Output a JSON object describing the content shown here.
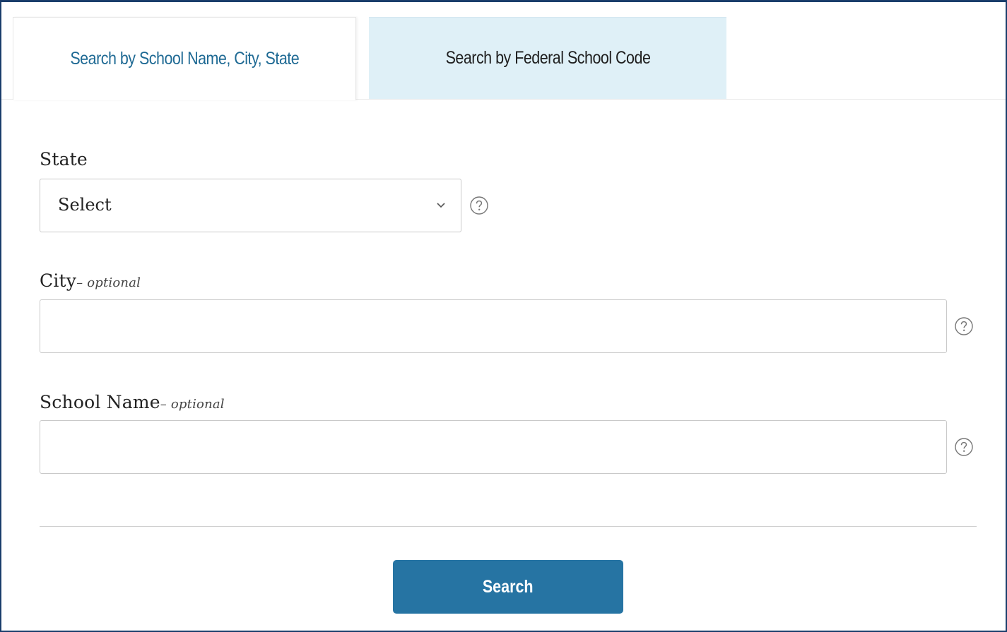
{
  "tabs": [
    {
      "label": "Search by School Name, City, State",
      "active": true
    },
    {
      "label": "Search by Federal School Code",
      "active": false
    }
  ],
  "form": {
    "state": {
      "label": "State",
      "selected": "Select"
    },
    "city": {
      "label": "City",
      "optional": "– optional",
      "value": "",
      "placeholder": ""
    },
    "school_name": {
      "label": "School Name",
      "optional": "– optional",
      "value": "",
      "placeholder": ""
    },
    "search_button": "Search"
  },
  "icons": {
    "help": "question-circle-icon",
    "chevron": "chevron-down-icon"
  },
  "colors": {
    "active_tab_text": "#1f6a94",
    "inactive_tab_bg": "#dff0f7",
    "button_bg": "#2674a3",
    "frame_border": "#1a3d6b"
  }
}
